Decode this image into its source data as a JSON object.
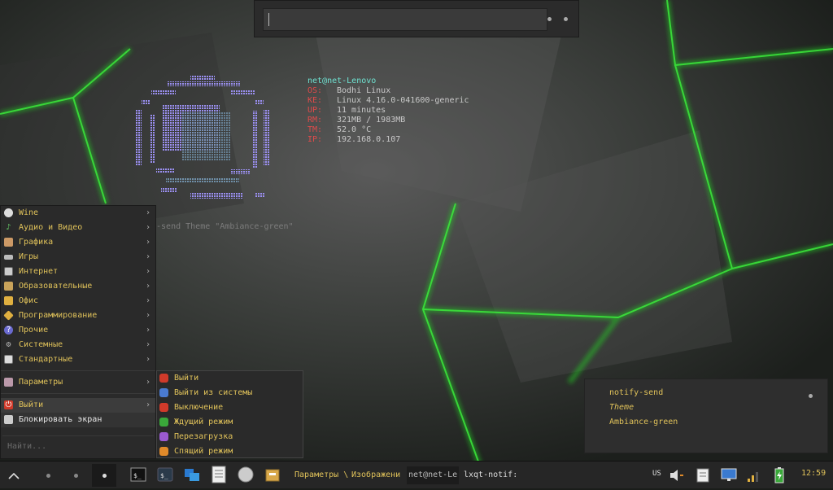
{
  "run_box": {
    "input_value": ""
  },
  "sysinfo": {
    "header": "net@net-Lenovo",
    "rows": [
      {
        "key": "OS:",
        "value": "Bodhi Linux"
      },
      {
        "key": "KE:",
        "value": "Linux 4.16.0-041600-generic"
      },
      {
        "key": "UP:",
        "value": "11 minutes"
      },
      {
        "key": "RM:",
        "value": "321MB / 1983MB"
      },
      {
        "key": "TM:",
        "value": "52.0 °C"
      },
      {
        "key": "IP:",
        "value": "192.168.0.107"
      }
    ]
  },
  "terminal_ghost": "y-send Theme \"Ambiance-green\"",
  "menu": {
    "categories": [
      {
        "label": "Wine",
        "icon": "wine-icon"
      },
      {
        "label": "Аудио и Видео",
        "icon": "audio-video-icon"
      },
      {
        "label": "Графика",
        "icon": "graphics-icon"
      },
      {
        "label": "Игры",
        "icon": "games-icon"
      },
      {
        "label": "Интернет",
        "icon": "internet-icon"
      },
      {
        "label": "Образовательные",
        "icon": "education-icon"
      },
      {
        "label": "Офис",
        "icon": "office-icon"
      },
      {
        "label": "Программирование",
        "icon": "programming-icon"
      },
      {
        "label": "Прочие",
        "icon": "other-icon"
      },
      {
        "label": "Системные",
        "icon": "system-icon"
      },
      {
        "label": "Стандартные",
        "icon": "accessories-icon"
      }
    ],
    "settings_label": "Параметры",
    "exit_label": "Выйти",
    "lock_label": "Блокировать экран",
    "search_placeholder": "Найти..."
  },
  "exit_submenu": [
    {
      "label": "Выйти",
      "icon": "power-icon"
    },
    {
      "label": "Выйти из системы",
      "icon": "logout-icon"
    },
    {
      "label": "Выключение",
      "icon": "shutdown-icon"
    },
    {
      "label": "Ждущий режим",
      "icon": "suspend-icon"
    },
    {
      "label": "Перезагрузка",
      "icon": "reboot-icon"
    },
    {
      "label": "Спящий режим",
      "icon": "hibernate-icon"
    }
  ],
  "notification": {
    "summary": "notify-send",
    "body_line1": "Theme",
    "body_line2": "Ambiance-green"
  },
  "taskbar": {
    "tasks": [
      {
        "label": "Параметры \\"
      },
      {
        "label": "Изображени"
      },
      {
        "label": "net@net-Le"
      },
      {
        "label": "lxqt-notif:"
      }
    ],
    "keyboard_layout": "US",
    "clock": "12:59",
    "launchers": [
      "terminal-icon",
      "terminal-dark-icon",
      "file-manager-icon",
      "text-editor-icon",
      "browser-icon",
      "archive-icon"
    ]
  },
  "colors": {
    "menu_text": "#e0c25a",
    "terminal_header": "#6fe3d2",
    "terminal_key": "#e04b4b",
    "wallpaper_lines": "#1fb01f"
  }
}
